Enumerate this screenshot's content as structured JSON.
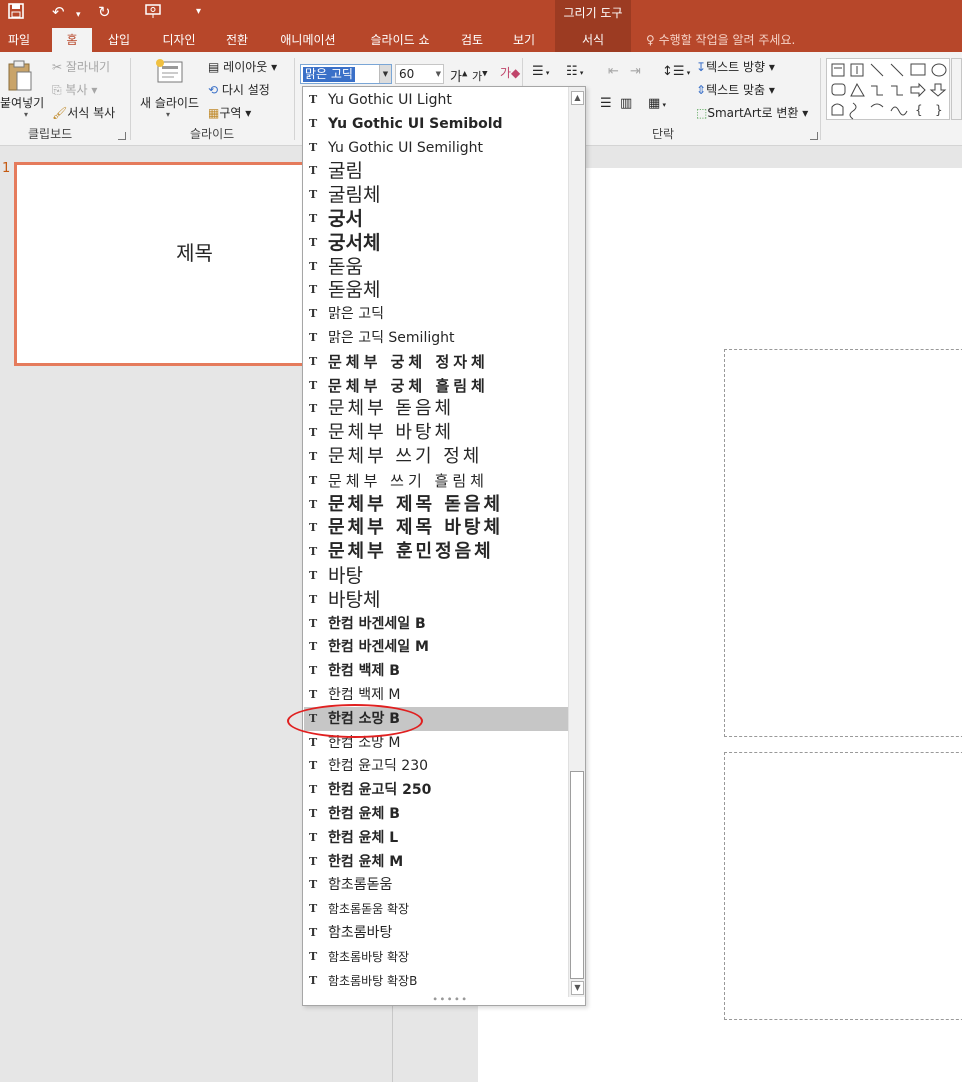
{
  "quick_access": {
    "save_icon": "save-icon",
    "undo_icon": "undo-icon",
    "redo_icon": "redo-icon",
    "present_icon": "present-icon",
    "customize_icon": "customize-icon"
  },
  "context_tab": {
    "title": "그리기 도구"
  },
  "tabs": [
    {
      "label": "파일"
    },
    {
      "label": "홈"
    },
    {
      "label": "삽입"
    },
    {
      "label": "디자인"
    },
    {
      "label": "전환"
    },
    {
      "label": "애니메이션"
    },
    {
      "label": "슬라이드 쇼"
    },
    {
      "label": "검토"
    },
    {
      "label": "보기"
    },
    {
      "label": "서식"
    }
  ],
  "tell_me": "수행할 작업을 알려 주세요.",
  "clipboard": {
    "paste": "붙여넣기",
    "cut": "잘라내기",
    "copy": "복사",
    "format_painter": "서식 복사",
    "label": "클립보드"
  },
  "slides": {
    "new_slide": "새 슬라이드",
    "layout": "레이아웃",
    "reset": "다시 설정",
    "section": "구역",
    "label": "슬라이드"
  },
  "font": {
    "current": "맑은 고딕",
    "size": "60",
    "grow": "가",
    "shrink": "가",
    "clear": "가"
  },
  "paragraph": {
    "label": "단락"
  },
  "text_tools": {
    "direction": "텍스트 방향",
    "align": "텍스트 맞춤",
    "smartart": "SmartArt로 변환"
  },
  "slide_panel": {
    "number": "1",
    "thumb_title": "제목"
  },
  "font_list": [
    {
      "name": "Yu Gothic UI Light",
      "style": "light"
    },
    {
      "name": "Yu Gothic UI Semibold",
      "style": "bold"
    },
    {
      "name": "Yu Gothic UI Semilight",
      "style": "light"
    },
    {
      "name": "굴림",
      "style": "large"
    },
    {
      "name": "굴림체",
      "style": "large"
    },
    {
      "name": "궁서",
      "style": "large-bold"
    },
    {
      "name": "궁서체",
      "style": "large-bold"
    },
    {
      "name": "돋움",
      "style": "large"
    },
    {
      "name": "돋움체",
      "style": "large"
    },
    {
      "name": "맑은 고딕",
      "style": "normal"
    },
    {
      "name": "맑은 고딕 Semilight",
      "style": "normal"
    },
    {
      "name": "문체부 궁체 정자체",
      "style": "wide-bold"
    },
    {
      "name": "문체부 궁체 흘림체",
      "style": "wide-bold"
    },
    {
      "name": "문체부 돋음체",
      "style": "wide-large"
    },
    {
      "name": "문체부 바탕체",
      "style": "wide-large"
    },
    {
      "name": "문체부 쓰기 정체",
      "style": "wide-large"
    },
    {
      "name": "문체부 쓰기 흘림체",
      "style": "wide"
    },
    {
      "name": "문체부 제목 돋음체",
      "style": "wide-large-bold"
    },
    {
      "name": "문체부 제목 바탕체",
      "style": "wide-large-bold"
    },
    {
      "name": "문체부 훈민정음체",
      "style": "wide-large-bold"
    },
    {
      "name": "바탕",
      "style": "large"
    },
    {
      "name": "바탕체",
      "style": "large"
    },
    {
      "name": "한컴 바겐세일 B",
      "style": "bold"
    },
    {
      "name": "한컴 바겐세일 M",
      "style": "bold"
    },
    {
      "name": "한컴 백제 B",
      "style": "bold"
    },
    {
      "name": "한컴 백제 M",
      "style": "normal"
    },
    {
      "name": "한컴 소망 B",
      "style": "bold"
    },
    {
      "name": "한컴 소망 M",
      "style": "normal"
    },
    {
      "name": "한컴 윤고딕 230",
      "style": "normal"
    },
    {
      "name": "한컴 윤고딕 250",
      "style": "bold"
    },
    {
      "name": "한컴 윤체 B",
      "style": "bold"
    },
    {
      "name": "한컴 윤체 L",
      "style": "bold"
    },
    {
      "name": "한컴 윤체 M",
      "style": "bold"
    },
    {
      "name": "함초롬돋움",
      "style": "normal"
    },
    {
      "name": "함초롬돋움 확장",
      "style": "small"
    },
    {
      "name": "함초롬바탕",
      "style": "normal"
    },
    {
      "name": "함초롬바탕 확장",
      "style": "small"
    },
    {
      "name": "함초롬바탕 확장B",
      "style": "small"
    }
  ],
  "selected_font": "한컴 소망 B",
  "accent_color": "#b7472a",
  "highlight_circle_color": "#e02020"
}
